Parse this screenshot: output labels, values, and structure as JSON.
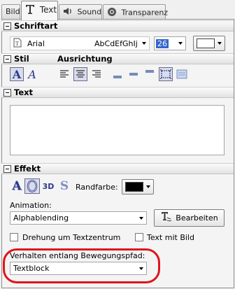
{
  "tabs": [
    {
      "label": "Bild",
      "active": false
    },
    {
      "label": "Text",
      "active": true,
      "icon": "T-icon"
    },
    {
      "label": "Sound",
      "active": false,
      "icon": "speaker-icon"
    },
    {
      "label": "Transparenz",
      "active": false,
      "icon": "camera-lens-icon"
    }
  ],
  "font_section": {
    "title": "Schriftart",
    "font_name": "Arial",
    "font_preview": "AbCdEfGhIj",
    "font_size": "26",
    "color_value": "#ffffff"
  },
  "style_section": {
    "title": "Stil",
    "alignment_title": "Ausrichtung",
    "style_letters": [
      "A",
      "A"
    ]
  },
  "text_section": {
    "title": "Text",
    "value": ""
  },
  "effect_section": {
    "title": "Effekt",
    "effect_letters": [
      "A",
      "3D",
      "S"
    ],
    "edge_color_label": "Randfarbe:",
    "edge_color_value": "#000000",
    "animation_label": "Animation:",
    "animation_value": "Alphablending",
    "edit_button": "Bearbeiten",
    "rotate_center_label": "Drehung um Textzentrum",
    "text_with_image_label": "Text mit Bild",
    "path_behavior_label": "Verhalten entlang Bewegungspfad:",
    "path_behavior_value": "Textblock"
  },
  "colors": {
    "highlight_ring": "#e0141c",
    "selected_tool": "#d9dcec",
    "size_field_highlight": "#3366cc"
  }
}
